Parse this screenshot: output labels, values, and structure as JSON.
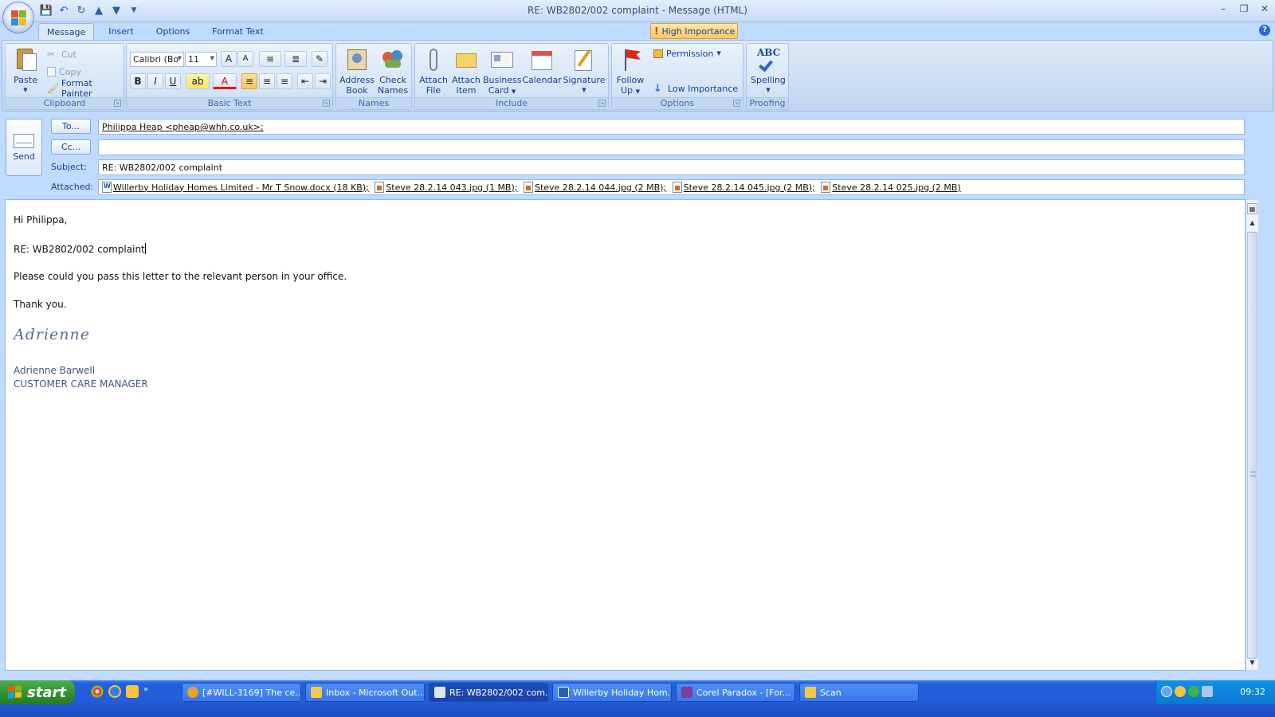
{
  "window": {
    "title": "RE: WB2802/002 complaint - Message (HTML)"
  },
  "ribbon": {
    "tabs": [
      "Message",
      "Insert",
      "Options",
      "Format Text"
    ],
    "clipboard": {
      "group": "Clipboard",
      "paste": "Paste",
      "cut": "Cut",
      "copy": "Copy",
      "format_painter": "Format Painter"
    },
    "basic_text": {
      "group": "Basic Text",
      "font": "Calibri (Bo",
      "size": "11"
    },
    "names": {
      "group": "Names",
      "address_book": [
        "Address",
        "Book"
      ],
      "check_names": [
        "Check",
        "Names"
      ]
    },
    "include": {
      "group": "Include",
      "attach_file": [
        "Attach",
        "File"
      ],
      "attach_item": [
        "Attach",
        "Item"
      ],
      "business_card": [
        "Business",
        "Card"
      ],
      "calendar": "Calendar",
      "signature": "Signature"
    },
    "options": {
      "group": "Options",
      "follow_up": [
        "Follow",
        "Up"
      ],
      "permission": "Permission",
      "high_importance": "High Importance",
      "low_importance": "Low Importance"
    },
    "proofing": {
      "group": "Proofing",
      "spelling": "Spelling",
      "abc": "ABC"
    }
  },
  "header": {
    "send": "Send",
    "to_button": "To...",
    "cc_button": "Cc...",
    "subject_label": "Subject:",
    "attached_label": "Attached:",
    "to_value": "Philippa Heap <pheap@whh.co.uk>;",
    "cc_value": "",
    "subject_value": "RE: WB2802/002 complaint",
    "attachments": [
      {
        "name": "Willerby Holiday Homes Limited - Mr T Snow.docx (18 KB);",
        "type": "word"
      },
      {
        "name": "Steve  28.2.14 043.jpg (1 MB);",
        "type": "img"
      },
      {
        "name": "Steve  28.2.14 044.jpg (2 MB);",
        "type": "img"
      },
      {
        "name": "Steve  28.2.14 045.jpg (2 MB);",
        "type": "img"
      },
      {
        "name": "Steve  28.2.14 025.jpg (2 MB)",
        "type": "img"
      }
    ]
  },
  "message": {
    "greeting": "Hi Philippa,",
    "reference": "RE: WB2802/002 complaint",
    "line1": "Please could you pass this letter to the relevant person in your office.",
    "thanks": "Thank you.",
    "signature_script": "Adrienne",
    "sender_name": "Adrienne Barwell",
    "sender_title": "CUSTOMER CARE MANAGER"
  },
  "taskbar": {
    "start": "start",
    "tasks": [
      {
        "label": "[#WILL-3169] The ce...",
        "icon_color": "#e8a12a"
      },
      {
        "label": "Inbox - Microsoft Out...",
        "icon_color": "#f2c94c"
      },
      {
        "label": "RE: WB2802/002 com...",
        "icon_color": "#dfe8f5"
      },
      {
        "label": "Willerby Holiday Hom...",
        "icon_color": "#2b5fb3"
      },
      {
        "label": "Corel Paradox - [For...",
        "icon_color": "#7b3fa0"
      },
      {
        "label": "Scan",
        "icon_color": "#f1c84b"
      }
    ],
    "clock": "09:32"
  }
}
